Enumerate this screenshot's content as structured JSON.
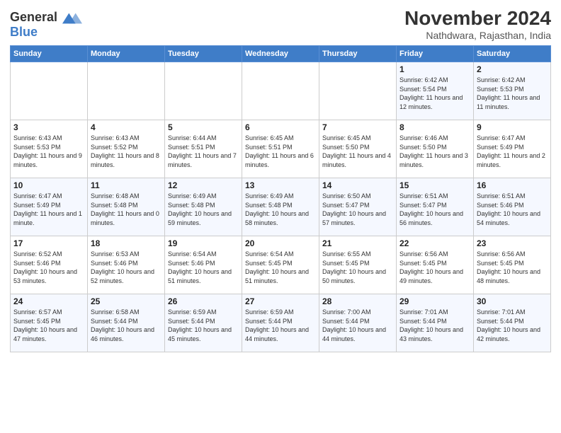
{
  "header": {
    "logo_line1": "General",
    "logo_line2": "Blue",
    "month_title": "November 2024",
    "subtitle": "Nathdwara, Rajasthan, India"
  },
  "weekdays": [
    "Sunday",
    "Monday",
    "Tuesday",
    "Wednesday",
    "Thursday",
    "Friday",
    "Saturday"
  ],
  "weeks": [
    [
      {
        "day": "",
        "info": ""
      },
      {
        "day": "",
        "info": ""
      },
      {
        "day": "",
        "info": ""
      },
      {
        "day": "",
        "info": ""
      },
      {
        "day": "",
        "info": ""
      },
      {
        "day": "1",
        "info": "Sunrise: 6:42 AM\nSunset: 5:54 PM\nDaylight: 11 hours and 12 minutes."
      },
      {
        "day": "2",
        "info": "Sunrise: 6:42 AM\nSunset: 5:53 PM\nDaylight: 11 hours and 11 minutes."
      }
    ],
    [
      {
        "day": "3",
        "info": "Sunrise: 6:43 AM\nSunset: 5:53 PM\nDaylight: 11 hours and 9 minutes."
      },
      {
        "day": "4",
        "info": "Sunrise: 6:43 AM\nSunset: 5:52 PM\nDaylight: 11 hours and 8 minutes."
      },
      {
        "day": "5",
        "info": "Sunrise: 6:44 AM\nSunset: 5:51 PM\nDaylight: 11 hours and 7 minutes."
      },
      {
        "day": "6",
        "info": "Sunrise: 6:45 AM\nSunset: 5:51 PM\nDaylight: 11 hours and 6 minutes."
      },
      {
        "day": "7",
        "info": "Sunrise: 6:45 AM\nSunset: 5:50 PM\nDaylight: 11 hours and 4 minutes."
      },
      {
        "day": "8",
        "info": "Sunrise: 6:46 AM\nSunset: 5:50 PM\nDaylight: 11 hours and 3 minutes."
      },
      {
        "day": "9",
        "info": "Sunrise: 6:47 AM\nSunset: 5:49 PM\nDaylight: 11 hours and 2 minutes."
      }
    ],
    [
      {
        "day": "10",
        "info": "Sunrise: 6:47 AM\nSunset: 5:49 PM\nDaylight: 11 hours and 1 minute."
      },
      {
        "day": "11",
        "info": "Sunrise: 6:48 AM\nSunset: 5:48 PM\nDaylight: 11 hours and 0 minutes."
      },
      {
        "day": "12",
        "info": "Sunrise: 6:49 AM\nSunset: 5:48 PM\nDaylight: 10 hours and 59 minutes."
      },
      {
        "day": "13",
        "info": "Sunrise: 6:49 AM\nSunset: 5:48 PM\nDaylight: 10 hours and 58 minutes."
      },
      {
        "day": "14",
        "info": "Sunrise: 6:50 AM\nSunset: 5:47 PM\nDaylight: 10 hours and 57 minutes."
      },
      {
        "day": "15",
        "info": "Sunrise: 6:51 AM\nSunset: 5:47 PM\nDaylight: 10 hours and 56 minutes."
      },
      {
        "day": "16",
        "info": "Sunrise: 6:51 AM\nSunset: 5:46 PM\nDaylight: 10 hours and 54 minutes."
      }
    ],
    [
      {
        "day": "17",
        "info": "Sunrise: 6:52 AM\nSunset: 5:46 PM\nDaylight: 10 hours and 53 minutes."
      },
      {
        "day": "18",
        "info": "Sunrise: 6:53 AM\nSunset: 5:46 PM\nDaylight: 10 hours and 52 minutes."
      },
      {
        "day": "19",
        "info": "Sunrise: 6:54 AM\nSunset: 5:46 PM\nDaylight: 10 hours and 51 minutes."
      },
      {
        "day": "20",
        "info": "Sunrise: 6:54 AM\nSunset: 5:45 PM\nDaylight: 10 hours and 51 minutes."
      },
      {
        "day": "21",
        "info": "Sunrise: 6:55 AM\nSunset: 5:45 PM\nDaylight: 10 hours and 50 minutes."
      },
      {
        "day": "22",
        "info": "Sunrise: 6:56 AM\nSunset: 5:45 PM\nDaylight: 10 hours and 49 minutes."
      },
      {
        "day": "23",
        "info": "Sunrise: 6:56 AM\nSunset: 5:45 PM\nDaylight: 10 hours and 48 minutes."
      }
    ],
    [
      {
        "day": "24",
        "info": "Sunrise: 6:57 AM\nSunset: 5:45 PM\nDaylight: 10 hours and 47 minutes."
      },
      {
        "day": "25",
        "info": "Sunrise: 6:58 AM\nSunset: 5:44 PM\nDaylight: 10 hours and 46 minutes."
      },
      {
        "day": "26",
        "info": "Sunrise: 6:59 AM\nSunset: 5:44 PM\nDaylight: 10 hours and 45 minutes."
      },
      {
        "day": "27",
        "info": "Sunrise: 6:59 AM\nSunset: 5:44 PM\nDaylight: 10 hours and 44 minutes."
      },
      {
        "day": "28",
        "info": "Sunrise: 7:00 AM\nSunset: 5:44 PM\nDaylight: 10 hours and 44 minutes."
      },
      {
        "day": "29",
        "info": "Sunrise: 7:01 AM\nSunset: 5:44 PM\nDaylight: 10 hours and 43 minutes."
      },
      {
        "day": "30",
        "info": "Sunrise: 7:01 AM\nSunset: 5:44 PM\nDaylight: 10 hours and 42 minutes."
      }
    ]
  ]
}
